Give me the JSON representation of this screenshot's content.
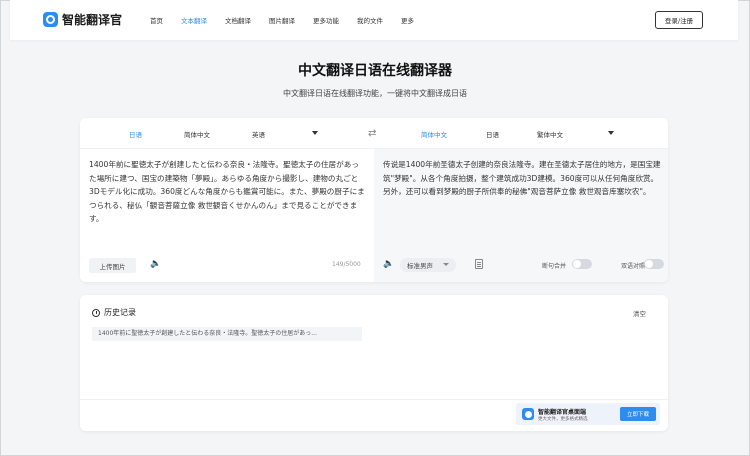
{
  "brand": {
    "name": "智能翻译官"
  },
  "nav": {
    "links": [
      "首页",
      "文本翻译",
      "文档翻译",
      "图片翻译",
      "更多功能",
      "我的文件",
      "更多"
    ],
    "active_index": 1,
    "login_label": "登录/注册"
  },
  "page": {
    "title": "中文翻译日语在线翻译器",
    "subtitle": "中文翻译日语在线翻译功能，一键将中文翻译成日语"
  },
  "translator": {
    "source_langs": [
      "日语",
      "简体中文",
      "英语"
    ],
    "source_active": 0,
    "target_langs": [
      "简体中文",
      "日语",
      "繁体中文"
    ],
    "target_active": 0,
    "source_text": "1400年前に聖徳太子が創建したと伝わる奈良・法隆寺。聖徳太子の住居があった場所に建つ、国宝の建築物「夢殿」。あらゆる角度から撮影し、建物の丸ごと3Dモデル化に成功。360度どんな角度からも鑑賞可能に。また、夢殿の厨子にまつられる、秘仏「観音菩薩立像 救世観音くせかんのん」まで見ることができます。",
    "target_text": "传说是1400年前圣德太子创建的奈良法隆寺。建在圣德太子居住的地方，是国宝建筑\"梦殿\"。从各个角度拍摄，整个建筑成功3D建模。360度可以从任何角度欣赏。另外，还可以看到梦殿的厨子所供奉的秘佛\"观音菩萨立像 救世观音库塞坎农\"。",
    "upload_label": "上传图片",
    "char_count": "149/5000",
    "voice_label": "标准男声",
    "toggle_sentence_label": "断句合并",
    "toggle_compare_label": "双语对照"
  },
  "history": {
    "title": "历史记录",
    "clear_label": "清空",
    "items": [
      "1400年前に聖徳太子が創建したと伝わる奈良・法隆寺。聖徳太子の住居があっ..."
    ]
  },
  "promo": {
    "title": "智能翻译官桌面端",
    "subtitle": "更大文件，更多格式精选",
    "download_label": "立即下载"
  },
  "colors": {
    "accent": "#2d8cf0"
  }
}
